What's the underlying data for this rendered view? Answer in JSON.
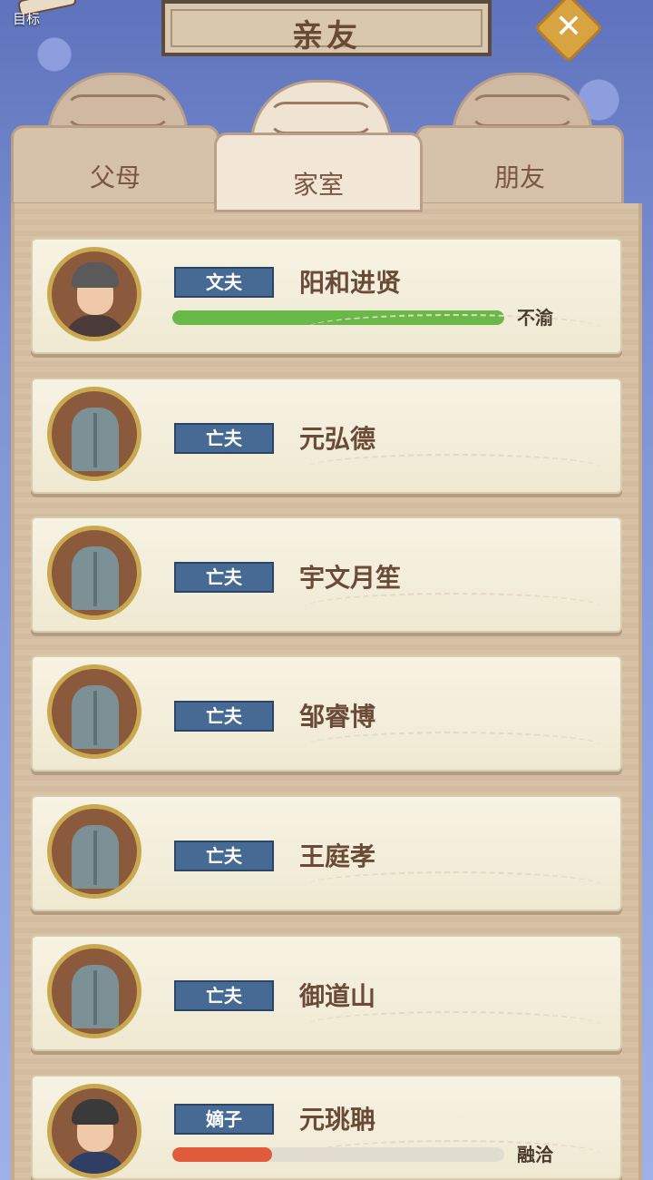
{
  "header": {
    "goal_label": "目标",
    "title": "亲友"
  },
  "tabs": [
    {
      "label": "父母",
      "active": false
    },
    {
      "label": "家室",
      "active": true
    },
    {
      "label": "朋友",
      "active": false
    }
  ],
  "colors": {
    "good_bar": "#6ab74a",
    "bad_bar": "#e05a3c",
    "role_tag": "#466a94"
  },
  "relatives": [
    {
      "role": "文夫",
      "name": "阳和进贤",
      "avatar": "man-portrait",
      "relation_level": 1.0,
      "relation_label": "不渝"
    },
    {
      "role": "亡夫",
      "name": "元弘德",
      "avatar": "tombstone"
    },
    {
      "role": "亡夫",
      "name": "宇文月笙",
      "avatar": "tombstone"
    },
    {
      "role": "亡夫",
      "name": "邹睿博",
      "avatar": "tombstone"
    },
    {
      "role": "亡夫",
      "name": "王庭孝",
      "avatar": "tombstone"
    },
    {
      "role": "亡夫",
      "name": "御道山",
      "avatar": "tombstone"
    },
    {
      "role": "嫡子",
      "name": "元珧聃",
      "avatar": "young-man-portrait",
      "relation_level": 0.3,
      "relation_label": "融洽"
    }
  ]
}
